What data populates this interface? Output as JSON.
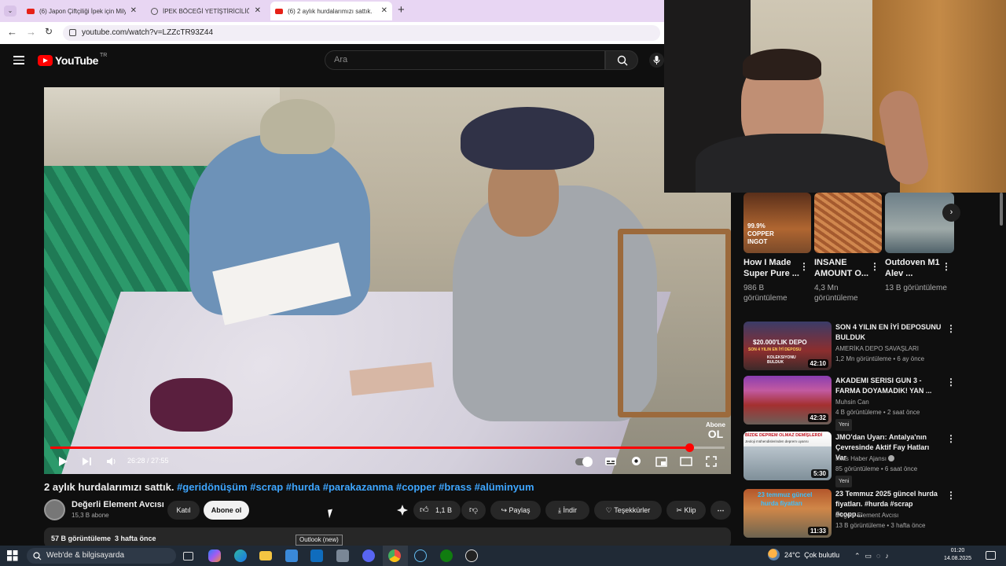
{
  "browser": {
    "tabs": [
      {
        "title": "(6) Japon Çiftçiliği İpek için Milyo",
        "active": false
      },
      {
        "title": "İPEK BÖCEĞİ YETİŞTİRİCİLİĞİ YA",
        "active": false
      },
      {
        "title": "(6) 2 aylık hurdalarımızı sattık. #",
        "active": true
      }
    ],
    "new_tab": "+",
    "url": "youtube.com/watch?v=LZZcTR93Z44"
  },
  "youtube": {
    "logo_text": "YouTube",
    "country": "TR",
    "search_placeholder": "Ara"
  },
  "player": {
    "current_time": "26:28",
    "duration": "27:55",
    "time_display": "26:28 / 27:55",
    "progress_fraction": 0.948,
    "subscribe_watermark_top": "Abone",
    "subscribe_watermark_bottom": "OL"
  },
  "video": {
    "title_plain": "2 aylık hurdalarımızı sattık. ",
    "title_tags": "#geridönüşüm #scrap #hurda #parakazanma #copper #brass #alüminyum",
    "channel_name": "Değerli Element Avcısı",
    "subscribers": "15,3 B abone",
    "join_label": "Katıl",
    "subscribe_label": "Abone ol",
    "likes": "1,1 B",
    "share_label": "Paylaş",
    "download_label": "İndir",
    "thanks_label": "Teşekkürler",
    "clip_label": "Klip",
    "views": "57 B görüntüleme",
    "age": "3 hafta önce"
  },
  "tooltip": "Outlook (new)",
  "shorts": [
    {
      "title": "How I Made Super Pure ...",
      "views": "986 B görüntüleme",
      "overlay": "99.9% COPPER INGOT"
    },
    {
      "title": "INSANE AMOUNT O...",
      "views": "4,3 Mn görüntüleme"
    },
    {
      "title": "Outdoven M1 Alev ...",
      "views": "13 B görüntüleme"
    }
  ],
  "recommendations": [
    {
      "title": "SON 4 YILIN EN İYİ DEPOSUNU BULDUK",
      "channel": "AMERİKA DEPO SAVAŞLARI",
      "views": "1,2 Mn görüntüleme",
      "age": "6 ay önce",
      "duration": "42:10",
      "new": ""
    },
    {
      "title": "AKADEMI SERISI GUN 3 - FARMA DOYAMADIK! YAN ...",
      "channel": "Muhsin Can",
      "views": "4 B görüntüleme",
      "age": "2 saat önce",
      "duration": "42:32",
      "new": "Yeni"
    },
    {
      "title": "JMO'dan Uyarı: Antalya'nın Çevresinde Aktif Fay Hatları Var",
      "channel": "İhlas Haber Ajansı",
      "views": "85 görüntüleme",
      "age": "6 saat önce",
      "duration": "5:30",
      "new": "Yeni"
    },
    {
      "title": "23 Temmuz 2025 güncel hurda fiyatları. #hurda #scrap #copp...",
      "channel": "Değerli Element Avcısı",
      "views": "13 B görüntüleme",
      "age": "3 hafta önce",
      "duration": "11:33",
      "new": ""
    }
  ],
  "thumb_text": {
    "rec1_line1": "$20.000'LIK DEPO",
    "rec1_line2": "SON 4 YILIN EN İYİ DEPOSU",
    "rec1_line3": "KOLEKSIYONU BULDUK",
    "rec3_line1": "BİZDE DEPREM OLMAZ DEMİŞLERDİ",
    "rec3_line2": "Jeoloji mühendislerinden deprem uyarısı",
    "rec4_line1": "23 temmuz güncel",
    "rec4_line2": "hurda fiyatları"
  },
  "taskbar": {
    "search_text": "Web'de & bilgisayarda",
    "temperature": "24°C",
    "weather": "Çok bulutlu",
    "time": "01:20",
    "date": "14.08.2025"
  }
}
